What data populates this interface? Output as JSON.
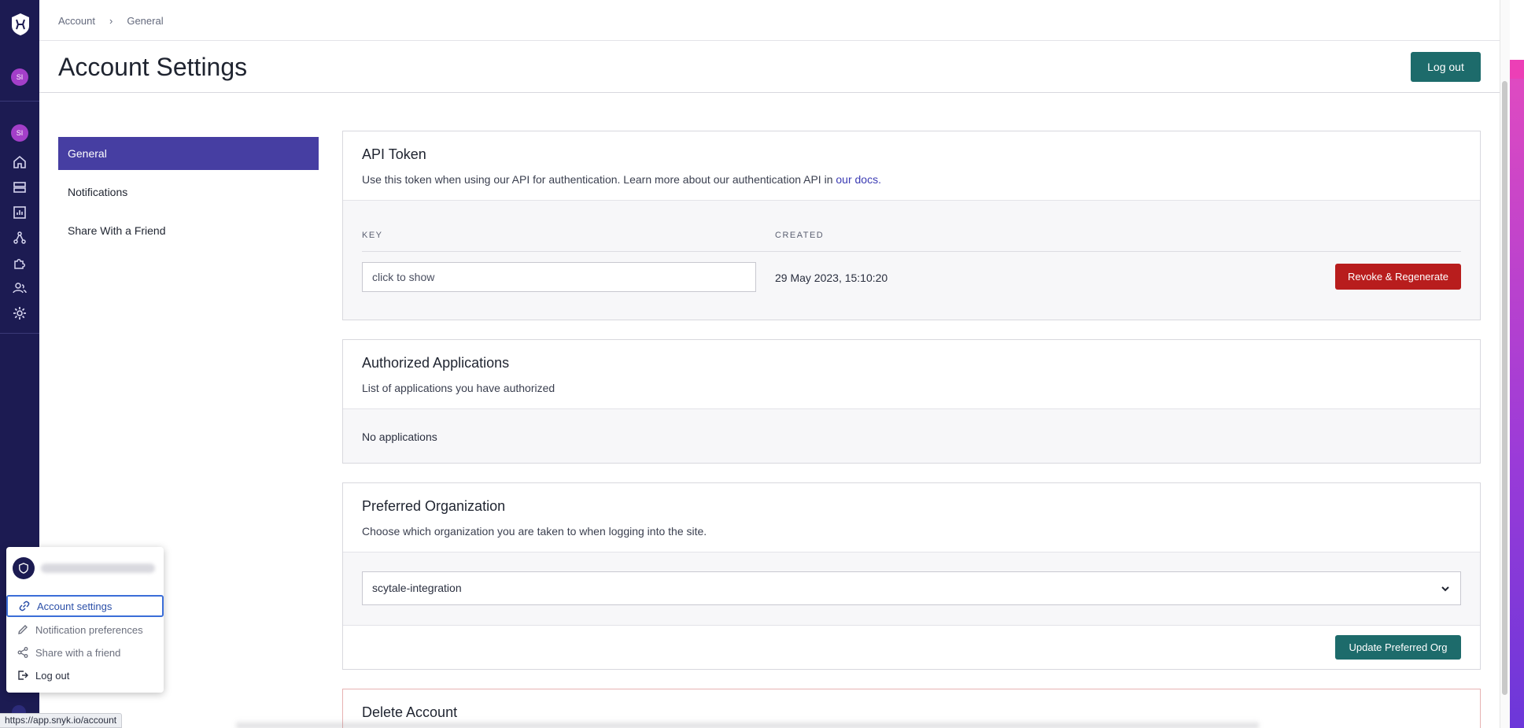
{
  "breadcrumb": {
    "root": "Account",
    "current": "General"
  },
  "header": {
    "title": "Account Settings",
    "logout_label": "Log out"
  },
  "rail": {
    "avatar_initials": "SI"
  },
  "settings_nav": {
    "items": [
      {
        "label": "General",
        "active": true
      },
      {
        "label": "Notifications",
        "active": false
      },
      {
        "label": "Share With a Friend",
        "active": false
      }
    ]
  },
  "api_token": {
    "title": "API Token",
    "desc_prefix": "Use this token when using our API for authentication. Learn more about our authentication API in ",
    "desc_link": "our docs",
    "desc_suffix": ".",
    "key_header": "KEY",
    "created_header": "CREATED",
    "key_placeholder": "click to show",
    "created_value": "29 May 2023, 15:10:20",
    "revoke_label": "Revoke & Regenerate"
  },
  "authorized_apps": {
    "title": "Authorized Applications",
    "desc": "List of applications you have authorized",
    "empty": "No applications"
  },
  "preferred_org": {
    "title": "Preferred Organization",
    "desc": "Choose which organization you are taken to when logging into the site.",
    "selected": "scytale-integration",
    "update_label": "Update Preferred Org"
  },
  "delete_account": {
    "title": "Delete Account"
  },
  "user_menu": {
    "items": [
      {
        "label": "Account settings"
      },
      {
        "label": "Notification preferences"
      },
      {
        "label": "Share with a friend"
      },
      {
        "label": "Log out"
      }
    ]
  },
  "status_bar": {
    "url": "https://app.snyk.io/account"
  },
  "colors": {
    "rail": "#1c1b52",
    "accent": "#463ea2",
    "teal": "#1d6b6b",
    "danger": "#b81d1d"
  }
}
